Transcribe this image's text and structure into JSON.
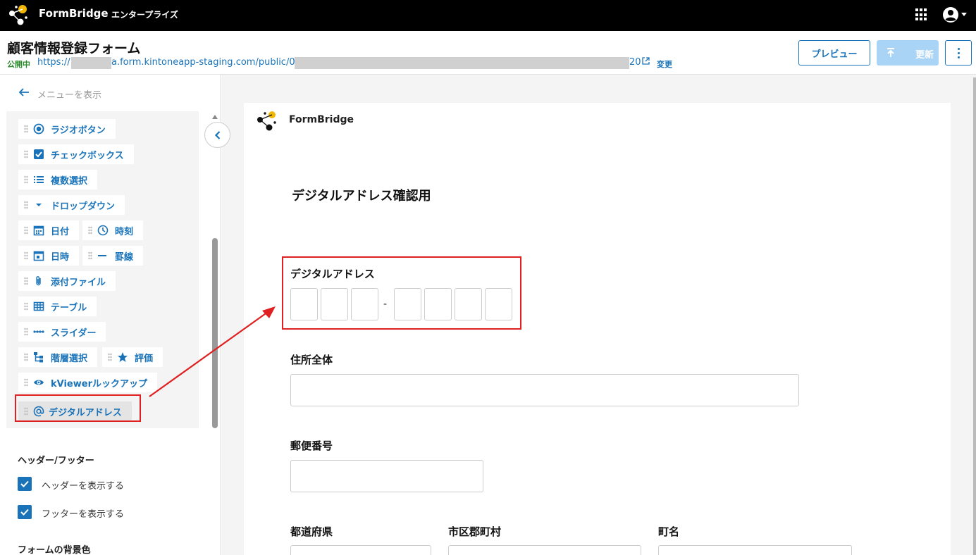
{
  "topbar": {
    "brand": "FormBridge",
    "edition": "エンタープライズ"
  },
  "header": {
    "title": "顧客情報登録フォーム",
    "status": "公開中",
    "url_prefix": "https://",
    "url_middle": "a.form.kintoneapp-staging.com/public/0",
    "url_suffix": "20",
    "change_label": "変更",
    "preview_label": "プレビュー",
    "update_label": "更新"
  },
  "left": {
    "show_menu": "メニューを表示",
    "fields": [
      {
        "label": "ラジオボタン",
        "icon": "radio-icon"
      },
      {
        "label": "チェックボックス",
        "icon": "checkbox-icon"
      },
      {
        "label": "複数選択",
        "icon": "list-icon"
      },
      {
        "label": "ドロップダウン",
        "icon": "caret-down-icon"
      },
      {
        "label": "日付",
        "icon": "calendar-icon"
      },
      {
        "label": "時刻",
        "icon": "clock-icon"
      },
      {
        "label": "日時",
        "icon": "calendar-event-icon"
      },
      {
        "label": "罫線",
        "icon": "horizontal-rule-icon"
      },
      {
        "label": "添付ファイル",
        "icon": "paperclip-icon"
      },
      {
        "label": "テーブル",
        "icon": "table-icon"
      },
      {
        "label": "スライダー",
        "icon": "slider-icon"
      },
      {
        "label": "階層選択",
        "icon": "hierarchy-icon"
      },
      {
        "label": "評価",
        "icon": "star-icon"
      },
      {
        "label": "kViewerルックアップ",
        "icon": "eye-icon"
      },
      {
        "label": "デジタルアドレス",
        "icon": "at-icon"
      }
    ],
    "header_footer_heading": "ヘッダー/フッター",
    "show_header_label": "ヘッダーを表示する",
    "show_footer_label": "フッターを表示する",
    "background_heading": "フォームの背景色"
  },
  "form": {
    "brand": "FormBridge",
    "title": "デジタルアドレス確認用",
    "digital_address_label": "デジタルアドレス",
    "dash": "-",
    "address_full_label": "住所全体",
    "postal_code_label": "郵便番号",
    "prefecture_label": "都道府県",
    "city_label": "市区郡町村",
    "town_label": "町名"
  },
  "colors": {
    "accent": "#1a73b8",
    "annotation": "#e02020",
    "published": "#2b8a2b"
  }
}
